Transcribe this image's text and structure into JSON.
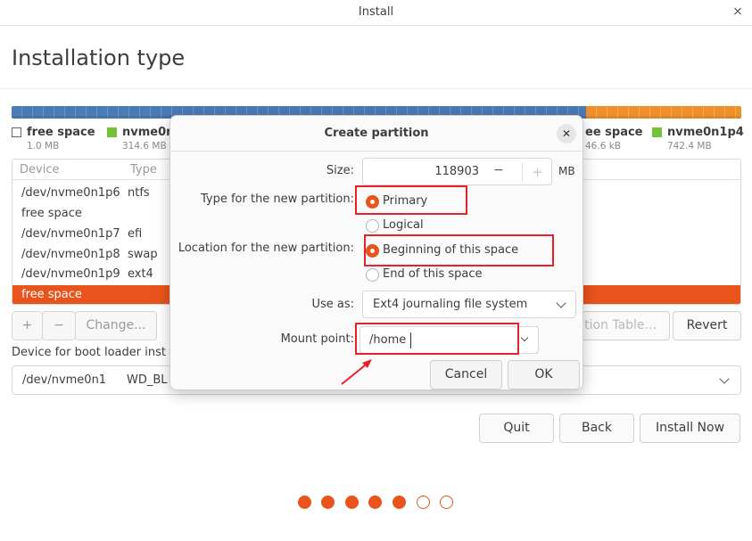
{
  "window": {
    "title": "Install",
    "close": "×"
  },
  "page_title": "Installation type",
  "legend": [
    {
      "name": "free space",
      "size": "1.0 MB",
      "color": "none"
    },
    {
      "name": "nvme0n",
      "size": "314.6 MB",
      "color": "#73c239"
    },
    {
      "name": "ee space",
      "size": "46.6 kB",
      "color": "none"
    },
    {
      "name": "nvme0n1p4",
      "size": "742.4 MB",
      "color": "#73c239"
    }
  ],
  "table": {
    "headers": [
      "Device",
      "Type"
    ],
    "rows": [
      {
        "device": "/dev/nvme0n1p6",
        "type": "ntfs"
      },
      {
        "device": "free space",
        "type": ""
      },
      {
        "device": "/dev/nvme0n1p7",
        "type": "efi"
      },
      {
        "device": "/dev/nvme0n1p8",
        "type": "swap"
      },
      {
        "device": "/dev/nvme0n1p9",
        "type": "ext4"
      },
      {
        "device": "free space",
        "type": "",
        "selected": true
      }
    ]
  },
  "table_buttons": {
    "add": "+",
    "remove": "−",
    "change": "Change...",
    "new_table": "tion Table...",
    "revert": "Revert"
  },
  "boot_loader": {
    "label": "Device for boot loader inst",
    "device": "/dev/nvme0n1",
    "model": "WD_BL"
  },
  "nav": {
    "quit": "Quit",
    "back": "Back",
    "install": "Install Now"
  },
  "progress": {
    "total": 7,
    "completed": 5
  },
  "dialog": {
    "title": "Create partition",
    "close": "✕",
    "size_label": "Size:",
    "size_value": "118903",
    "size_minus": "−",
    "size_plus": "+",
    "size_unit": "MB",
    "type_label": "Type for the new partition:",
    "type_primary": "Primary",
    "type_logical": "Logical",
    "location_label": "Location for the new partition:",
    "location_begin": "Beginning of this space",
    "location_end": "End of this space",
    "useas_label": "Use as:",
    "useas_value": "Ext4 journaling file system",
    "mount_label": "Mount point:",
    "mount_value": "/home",
    "cancel": "Cancel",
    "ok": "OK"
  },
  "colors": {
    "accent": "#e9541c",
    "annotation": "#e8202a"
  }
}
